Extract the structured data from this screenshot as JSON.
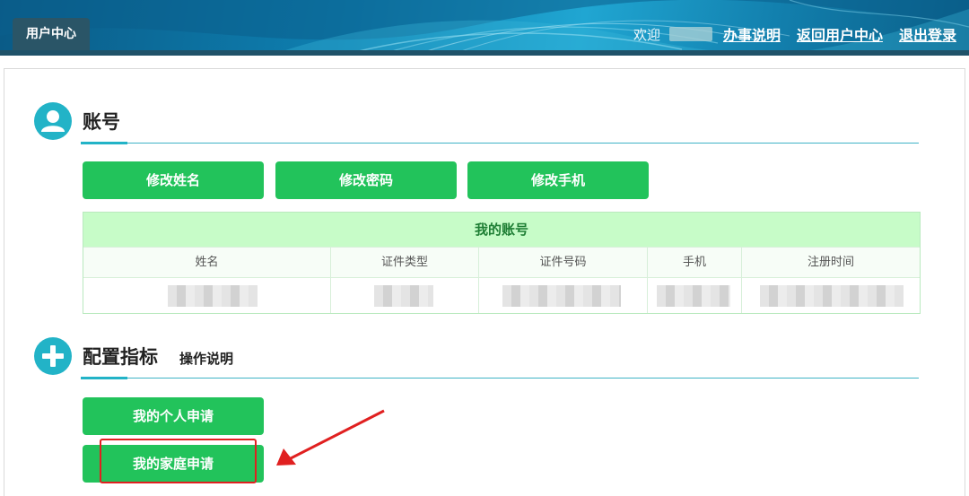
{
  "header": {
    "tab_label": "用户中心",
    "welcome_text": "欢迎",
    "links": [
      "办事说明",
      "返回用户中心",
      "退出登录"
    ]
  },
  "account_section": {
    "title": "账号",
    "icon": "user-icon",
    "buttons": [
      "修改姓名",
      "修改密码",
      "修改手机"
    ],
    "table": {
      "caption": "我的账号",
      "columns": [
        "姓名",
        "证件类型",
        "证件号码",
        "手机",
        "注册时间"
      ]
    }
  },
  "config_section": {
    "title": "配置指标",
    "subtitle": "操作说明",
    "icon": "plus-icon",
    "buttons": [
      "我的个人申请",
      "我的家庭申请"
    ]
  },
  "colors": {
    "header_bg": "#0e7fb0",
    "tab_bg": "#2a5567",
    "accent_teal": "#22b3c7",
    "button_green": "#22c35b",
    "table_caption_bg": "#c7fcc8",
    "highlight_red": "#e02020"
  }
}
